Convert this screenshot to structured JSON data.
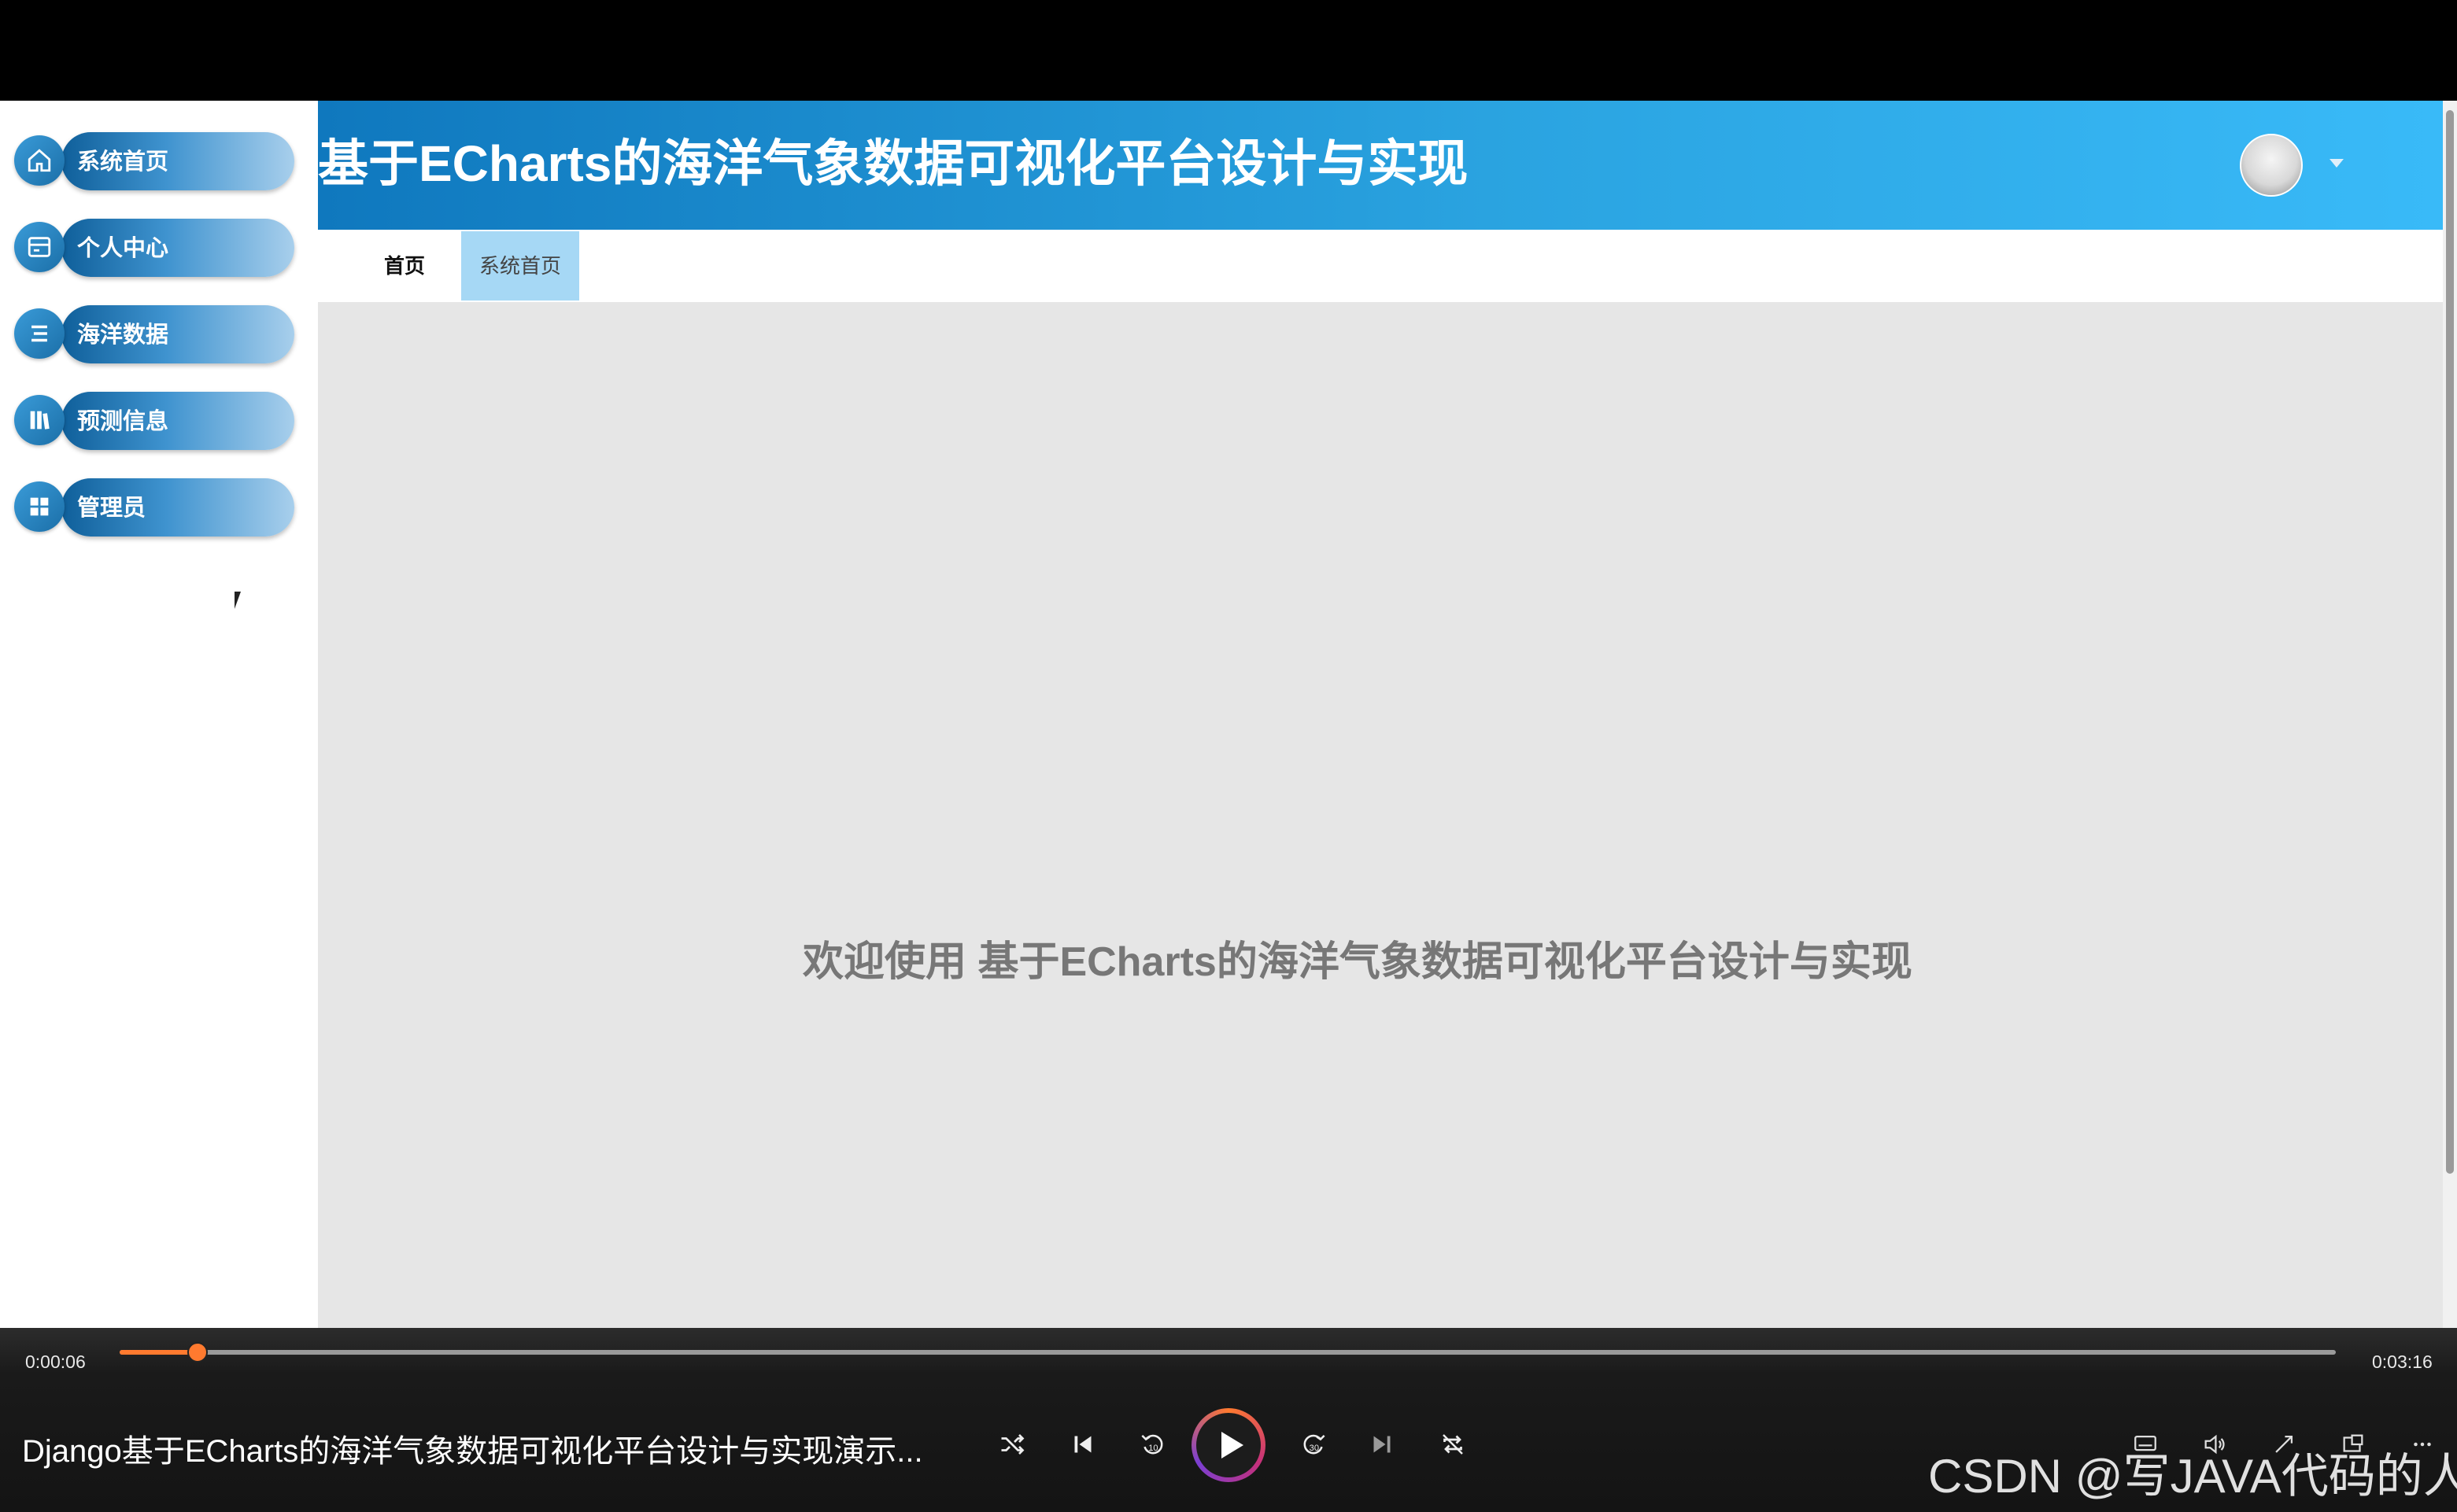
{
  "sidebar": {
    "items": [
      {
        "label": "系统首页",
        "icon": "home-icon"
      },
      {
        "label": "个人中心",
        "icon": "profile-card-icon"
      },
      {
        "label": "海洋数据",
        "icon": "list-icon"
      },
      {
        "label": "预测信息",
        "icon": "library-icon"
      },
      {
        "label": "管理员",
        "icon": "grid-icon"
      }
    ]
  },
  "header": {
    "title": "基于ECharts的海洋气象数据可视化平台设计与实现"
  },
  "tabs": {
    "home": "首页",
    "system_home": "系统首页"
  },
  "main": {
    "welcome": "欢迎使用 基于ECharts的海洋气象数据可视化平台设计与实现"
  },
  "player": {
    "current_time": "0:00:06",
    "total_time": "0:03:16",
    "progress": 0.035,
    "video_title": "Django基于ECharts的海洋气象数据可视化平台设计与实现演示...",
    "accent": "#ff7a2f",
    "controls": [
      "shuffle-icon",
      "previous-icon",
      "rewind-10-icon",
      "play-icon",
      "forward-30-icon",
      "next-icon",
      "repeat-icon"
    ]
  },
  "watermark": "CSDN @写JAVA代码的人",
  "colors": {
    "header_start": "#0f78be",
    "header_end": "#39baf8",
    "active_tab": "#a6d8f5",
    "main_bg": "#e6e6e6"
  }
}
